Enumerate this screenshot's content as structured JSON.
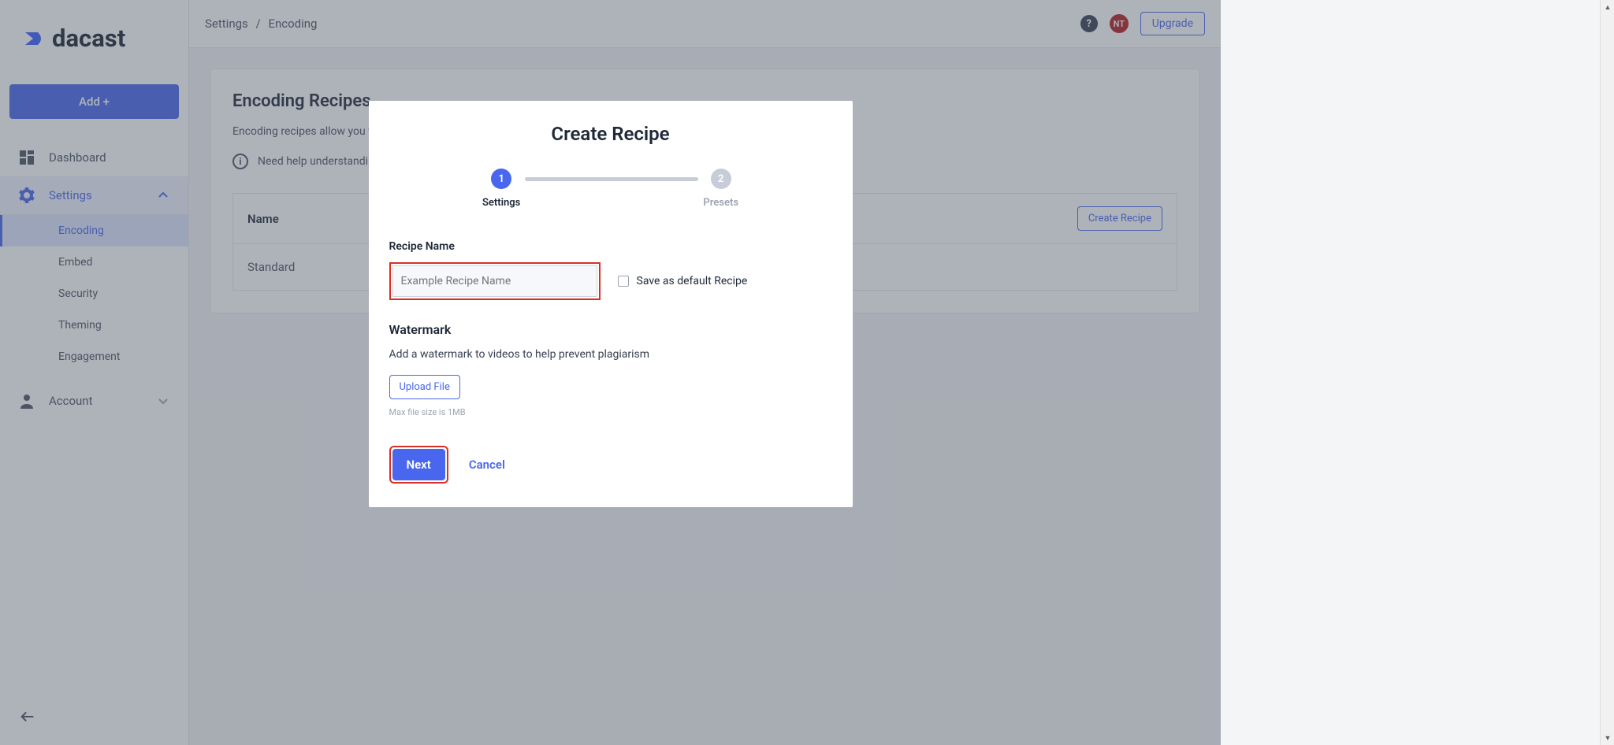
{
  "brand": {
    "name": "dacast"
  },
  "sidebar": {
    "add_label": "Add +",
    "items": [
      {
        "label": "Dashboard"
      },
      {
        "label": "Settings"
      },
      {
        "label": "Account"
      }
    ],
    "settings_children": [
      {
        "label": "Encoding"
      },
      {
        "label": "Embed"
      },
      {
        "label": "Security"
      },
      {
        "label": "Theming"
      },
      {
        "label": "Engagement"
      }
    ]
  },
  "topbar": {
    "breadcrumb_parent": "Settings",
    "breadcrumb_sep": "/",
    "breadcrumb_current": "Encoding",
    "upgrade_label": "Upgrade",
    "avatar_initials": "NT",
    "help_symbol": "?"
  },
  "page": {
    "title": "Encoding Recipes",
    "description": "Encoding recipes allow you t",
    "help_text": "Need help understandin",
    "table_header": "Name",
    "create_button": "Create Recipe",
    "rows": [
      {
        "name": "Standard"
      }
    ]
  },
  "modal": {
    "title": "Create Recipe",
    "steps": [
      {
        "num": "1",
        "label": "Settings"
      },
      {
        "num": "2",
        "label": "Presets"
      }
    ],
    "recipe_name_label": "Recipe Name",
    "recipe_name_placeholder": "Example Recipe Name",
    "save_default_label": "Save as default Recipe",
    "watermark_title": "Watermark",
    "watermark_desc": "Add a watermark to videos to help prevent plagiarism",
    "upload_label": "Upload File",
    "max_size": "Max file size is 1MB",
    "next_label": "Next",
    "cancel_label": "Cancel"
  }
}
